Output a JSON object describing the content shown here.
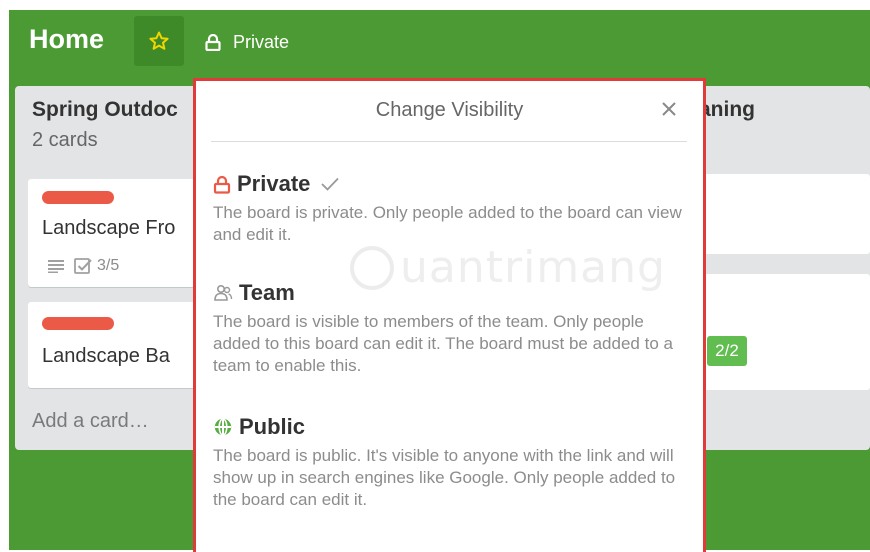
{
  "header": {
    "board_title": "Home",
    "visibility_label": "Private"
  },
  "lists": {
    "left": {
      "title": "Spring Outdoc",
      "count": "2 cards",
      "cards": [
        {
          "title": "Landscape Fro",
          "checklist": "3/5"
        },
        {
          "title": "Landscape Ba"
        }
      ],
      "add_card": "Add a card…"
    },
    "right": {
      "title": "aning",
      "badge": "2/2"
    }
  },
  "popup": {
    "title": "Change Visibility",
    "options": [
      {
        "name": "Private",
        "description": "The board is private. Only people added to the board can view and edit it.",
        "selected": true
      },
      {
        "name": "Team",
        "description": "The board is visible to members of the team. Only people added to this board can edit it. The board must be added to a team to enable this."
      },
      {
        "name": "Public",
        "description": "The board is public. It's visible to anyone with the link and will show up in search engines like Google. Only people added to the board can edit it."
      }
    ]
  },
  "watermark": "uantrimang",
  "colors": {
    "board_bg": "#4c9a33",
    "popup_border": "#e03b3b",
    "label_red": "#eb5a46",
    "badge_green": "#61bd4f",
    "public_icon": "#5aac44"
  }
}
